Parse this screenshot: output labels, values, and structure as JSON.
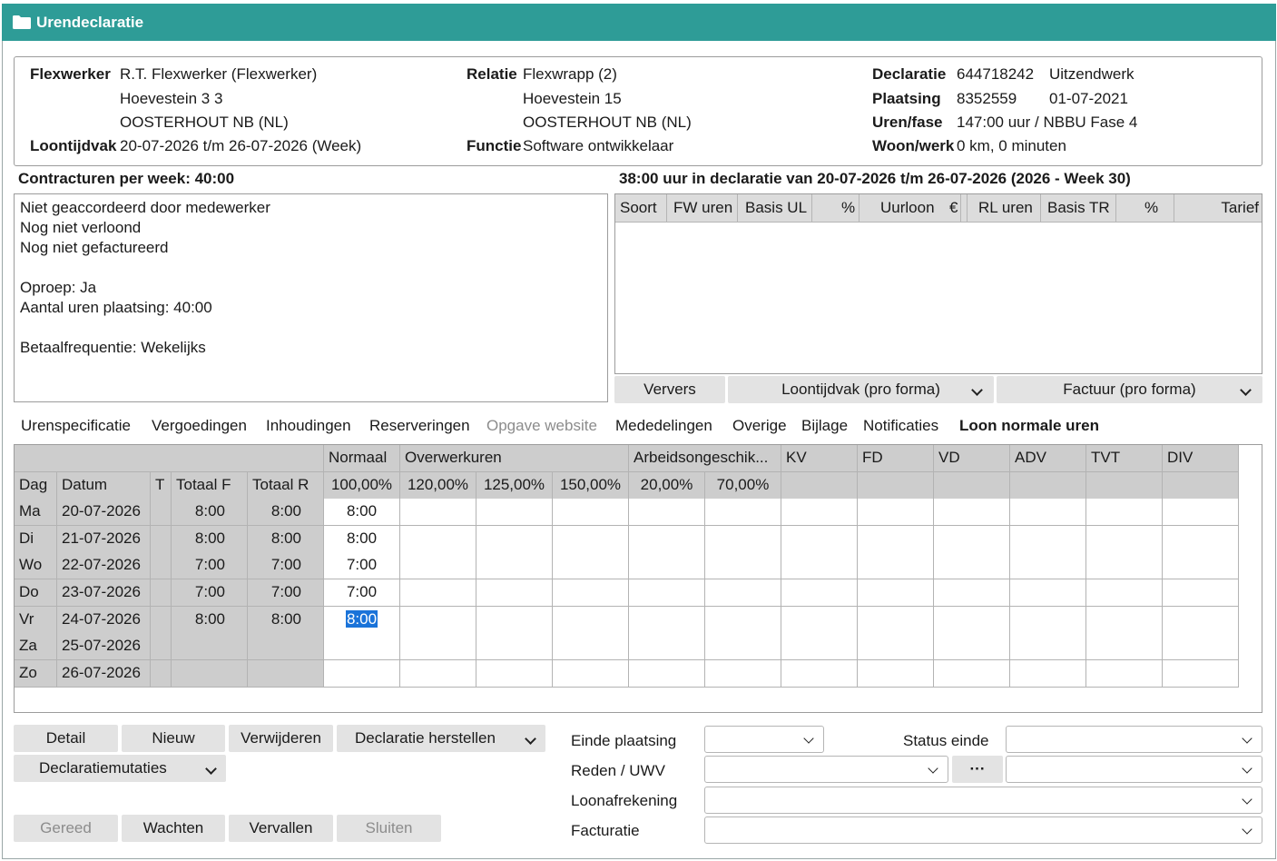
{
  "window": {
    "title": "Urendeclaratie"
  },
  "header": {
    "flexwerker_label": "Flexwerker",
    "flexwerker_name": "R.T. Flexwerker (Flexwerker)",
    "flexwerker_address1": "Hoevestein 3 3",
    "flexwerker_address2": "OOSTERHOUT NB (NL)",
    "loontijdvak_label": "Loontijdvak",
    "loontijdvak_value": "20-07-2026 t/m 26-07-2026 (Week)",
    "relatie_label": "Relatie",
    "relatie_name": "Flexwrapp (2)",
    "relatie_address1": "Hoevestein 15",
    "relatie_address2": "OOSTERHOUT NB (NL)",
    "functie_label": "Functie",
    "functie_value": "Software ontwikkelaar",
    "declaratie_label": "Declaratie",
    "declaratie_number": "644718242",
    "declaratie_type": "Uitzendwerk",
    "plaatsing_label": "Plaatsing",
    "plaatsing_number": "8352559",
    "plaatsing_date": "01-07-2021",
    "urenfase_label": "Uren/fase",
    "urenfase_value": "147:00 uur / NBBU Fase 4",
    "woonwerk_label": "Woon/werk",
    "woonwerk_value": "0 km, 0 minuten"
  },
  "contract": {
    "label": "Contracturen per week: 40:00"
  },
  "notes": {
    "lines": [
      "Niet geaccordeerd door medewerker",
      "Nog niet verloond",
      "Nog niet gefactureerd",
      "",
      "Oproep: Ja",
      "Aantal uren plaatsing: 40:00",
      "",
      "Betaalfrequentie: Wekelijks"
    ]
  },
  "declaration": {
    "summary": "38:00 uur in declaratie van 20-07-2026 t/m 26-07-2026 (2026 - Week 30)",
    "columns": [
      "Soort",
      "FW uren",
      "Basis UL",
      "%",
      "Uurloon",
      "€",
      "RL uren",
      "Basis TR",
      "%",
      "Tarief"
    ]
  },
  "actions": {
    "ververs": "Ververs",
    "loontijdvak": "Loontijdvak (pro forma)",
    "factuur": "Factuur (pro forma)"
  },
  "tabs": [
    {
      "label": "Urenspecificatie",
      "state": "normal"
    },
    {
      "label": "Vergoedingen",
      "state": "normal"
    },
    {
      "label": "Inhoudingen",
      "state": "normal"
    },
    {
      "label": "Reserveringen",
      "state": "normal"
    },
    {
      "label": "Opgave website",
      "state": "disabled"
    },
    {
      "label": "Mededelingen",
      "state": "normal"
    },
    {
      "label": "Overige",
      "state": "normal"
    },
    {
      "label": "Bijlage",
      "state": "normal"
    },
    {
      "label": "Notificaties",
      "state": "normal"
    },
    {
      "label": "Loon normale uren",
      "state": "active"
    }
  ],
  "grid": {
    "group_headers": [
      "Normaal",
      "Overwerkuren",
      "Arbeidsongeschik...",
      "KV",
      "FD",
      "VD",
      "ADV",
      "TVT",
      "DIV"
    ],
    "col_headers": [
      "Dag",
      "Datum",
      "T",
      "Totaal F",
      "Totaal R",
      "100,00%",
      "120,00%",
      "125,00%",
      "150,00%",
      "20,00%",
      "70,00%"
    ],
    "rows": [
      {
        "dag": "Ma",
        "datum": "20-07-2026",
        "t": "",
        "totaal_f": "8:00",
        "totaal_r": "8:00",
        "normaal": "8:00"
      },
      {
        "dag": "Di",
        "datum": "21-07-2026",
        "t": "",
        "totaal_f": "8:00",
        "totaal_r": "8:00",
        "normaal": "8:00"
      },
      {
        "dag": "Wo",
        "datum": "22-07-2026",
        "t": "",
        "totaal_f": "7:00",
        "totaal_r": "7:00",
        "normaal": "7:00"
      },
      {
        "dag": "Do",
        "datum": "23-07-2026",
        "t": "",
        "totaal_f": "7:00",
        "totaal_r": "7:00",
        "normaal": "7:00"
      },
      {
        "dag": "Vr",
        "datum": "24-07-2026",
        "t": "",
        "totaal_f": "8:00",
        "totaal_r": "8:00",
        "normaal": "8:00"
      },
      {
        "dag": "Za",
        "datum": "25-07-2026",
        "t": "",
        "totaal_f": "",
        "totaal_r": "",
        "normaal": ""
      },
      {
        "dag": "Zo",
        "datum": "26-07-2026",
        "t": "",
        "totaal_f": "",
        "totaal_r": "",
        "normaal": ""
      }
    ],
    "selected_row": 4
  },
  "buttons": {
    "detail": "Detail",
    "nieuw": "Nieuw",
    "verwijderen": "Verwijderen",
    "herstellen": "Declaratie herstellen",
    "mutaties": "Declaratiemutaties",
    "gereed": "Gereed",
    "wachten": "Wachten",
    "vervallen": "Vervallen",
    "sluiten": "Sluiten"
  },
  "form": {
    "einde_plaatsing": "Einde plaatsing",
    "status_einde": "Status einde",
    "reden_uwv": "Reden / UWV",
    "loonafrekening": "Loonafrekening",
    "facturatie": "Facturatie",
    "ellipsis": "···"
  }
}
